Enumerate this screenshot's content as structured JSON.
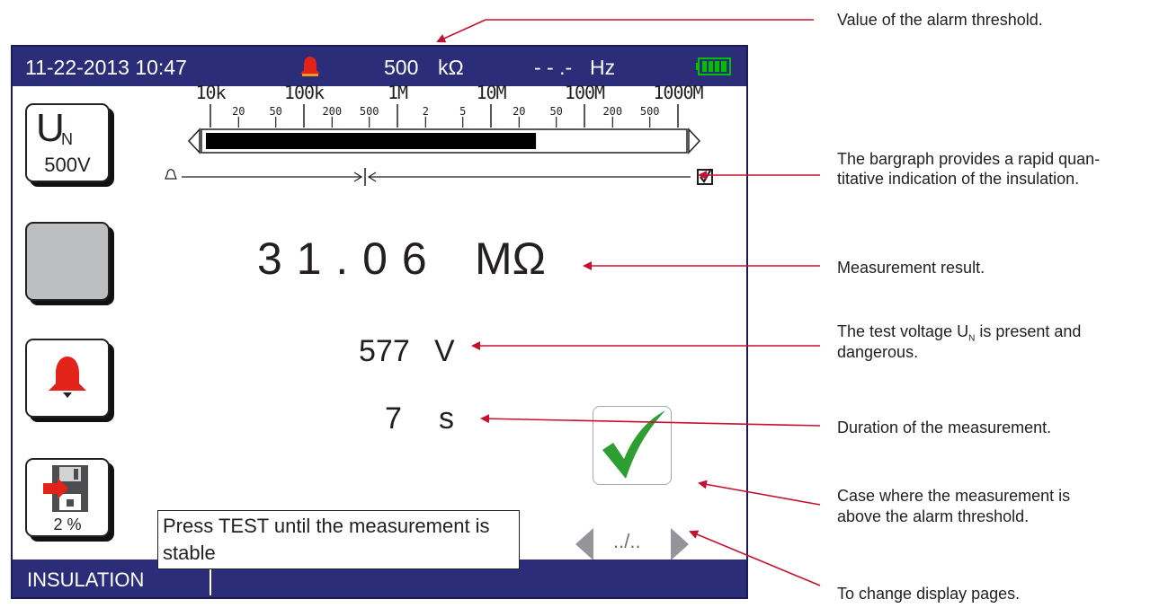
{
  "status_bar": {
    "datetime": "11-22-2013 10:47",
    "alarm_value": "500",
    "alarm_unit": "kΩ",
    "frequency": "- - .-",
    "frequency_unit": "Hz",
    "battery_color": "#00c000"
  },
  "bargraph": {
    "decade_labels": [
      "10k",
      "100k",
      "1M",
      "10M",
      "100M",
      "1000M"
    ],
    "minor_labels": [
      "20",
      "50",
      "200",
      "500",
      "2",
      "5",
      "20",
      "50",
      "200",
      "500"
    ],
    "fill_fraction": 0.69
  },
  "left_buttons": {
    "un_letter": "U",
    "un_subscript": "N",
    "un_voltage": "500V",
    "save_percent": "2 %"
  },
  "result": {
    "value": "3 1 . 0 6",
    "unit": "MΩ"
  },
  "voltage": {
    "value": "577",
    "unit": "V"
  },
  "duration": {
    "value": "7",
    "unit": "s"
  },
  "message": "Press TEST until the measurement is stable",
  "page_indicator": "../..",
  "mode": "INSULATION",
  "colors": {
    "bar_blue": "#2b2d78",
    "alarm_red": "#e2231a",
    "check_green": "#2e9e32",
    "arrow_red": "#c8102e"
  },
  "annotations": {
    "alarm_threshold": "Value of the alarm threshold.",
    "bargraph_line1": "The bargraph provides a rapid quan-",
    "bargraph_line2": "titative indication of the insulation.",
    "measurement_result": "Measurement result.",
    "test_voltage_line1a": "The test voltage U",
    "test_voltage_sub": "N",
    "test_voltage_line1b": " is present and",
    "test_voltage_line2": "dangerous.",
    "duration": "Duration of the measurement.",
    "above_threshold_line1": "Case where the measurement is",
    "above_threshold_line2": "above the alarm threshold.",
    "change_pages": "To change display pages."
  }
}
